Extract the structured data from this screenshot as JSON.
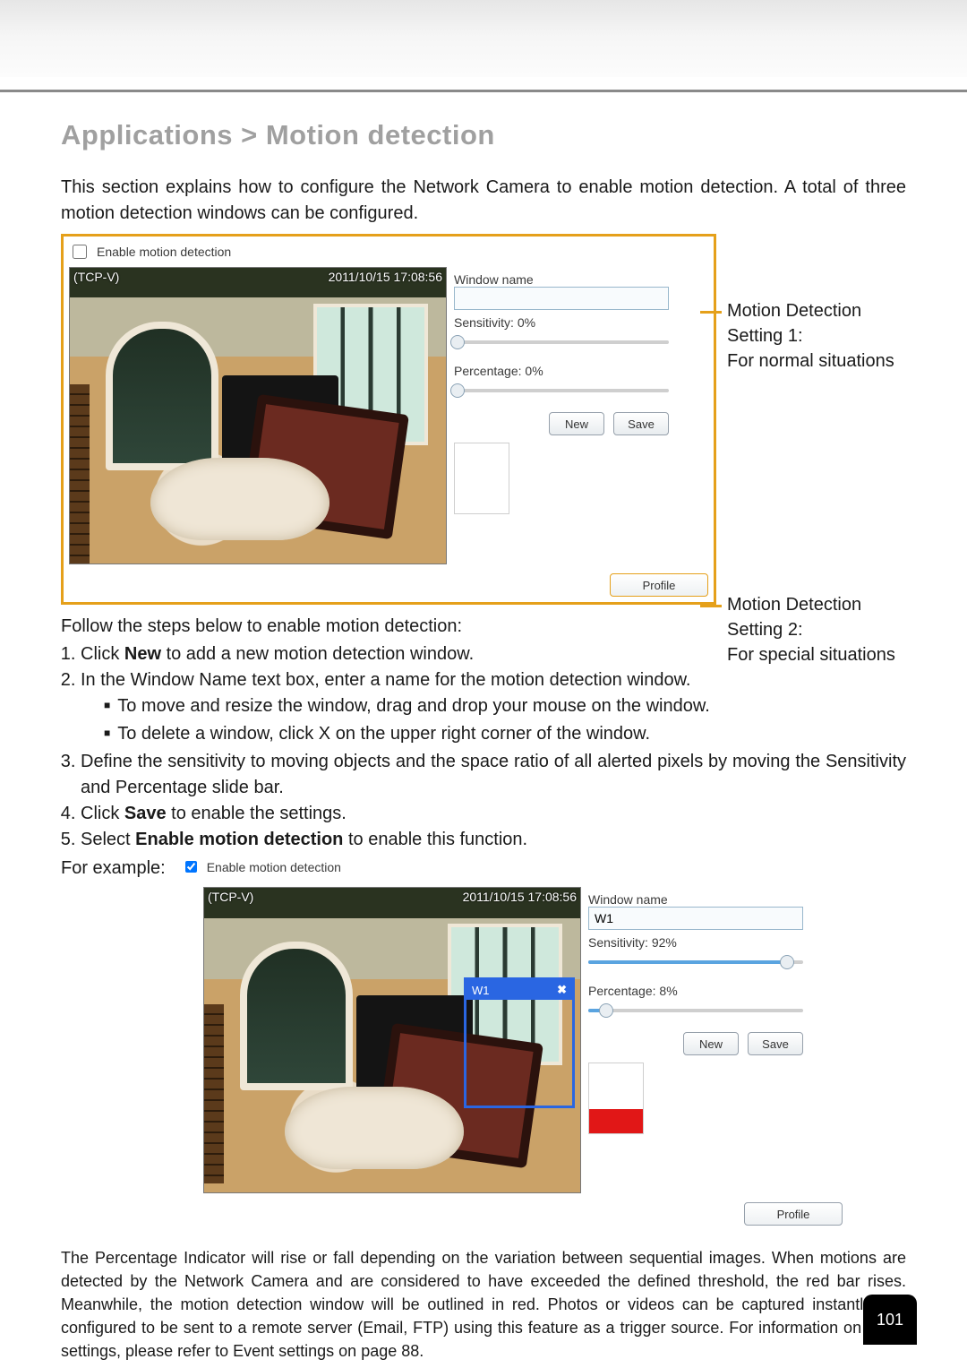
{
  "page_title": "Applications > Motion detection",
  "intro": "This section explains how to configure the Network Camera to enable motion detection. A total of three motion detection windows can be configured.",
  "annot": {
    "s1_line1": "Motion Detection Setting 1:",
    "s1_line2": "For normal situations",
    "s2_line1": "Motion Detection Setting 2:",
    "s2_line2": "For special situations"
  },
  "follow": "Follow the steps below to enable motion detection:",
  "steps": {
    "s1_a": "Click ",
    "s1_b": "New",
    "s1_c": " to add a new motion detection window.",
    "s2": "In the Window Name text box, enter a name for the motion detection window.",
    "s2_sub1": "To move and resize the window, drag and drop your mouse on the window.",
    "s2_sub2": "To delete a window, click X on the upper right corner of the window.",
    "s3": "Define the sensitivity to moving objects and the space ratio of all alerted pixels by moving the Sensitivity and Percentage slide bar.",
    "s4_a": "Click ",
    "s4_b": "Save",
    "s4_c": " to enable the settings.",
    "s5_a": "Select ",
    "s5_b": "Enable motion detection",
    "s5_c": " to enable this function."
  },
  "for_example": "For example:",
  "screenshot": {
    "enable_label": "Enable motion detection",
    "camera_name": "(TCP-V)",
    "timestamp": "2011/10/15  17:08:56",
    "window_name_label": "Window name",
    "sensitivity_label": "Sensitivity",
    "percentage_label": "Percentage",
    "new_btn": "New",
    "save_btn": "Save",
    "profile_btn": "Profile"
  },
  "shot1": {
    "enable_checked": false,
    "window_name": "",
    "sensitivity": 0,
    "percentage": 0
  },
  "shot2": {
    "enable_checked": true,
    "window_name": "W1",
    "sensitivity": 92,
    "percentage": 8,
    "sel_window_label": "W1",
    "sel_window_close": "✖",
    "indicator_fill_pct": 35
  },
  "closing": "The Percentage Indicator will rise or fall depending on the variation between sequential images. When motions are detected by the Network Camera and are considered to have exceeded the defined threshold, the red bar rises. Meanwhile, the motion detection window will be outlined in red. Photos or videos can be captured instantly and configured to be sent to a remote server (Email, FTP) using this feature as a trigger source. For information on event settings, please refer to Event settings on page 88.",
  "page_number": "101"
}
